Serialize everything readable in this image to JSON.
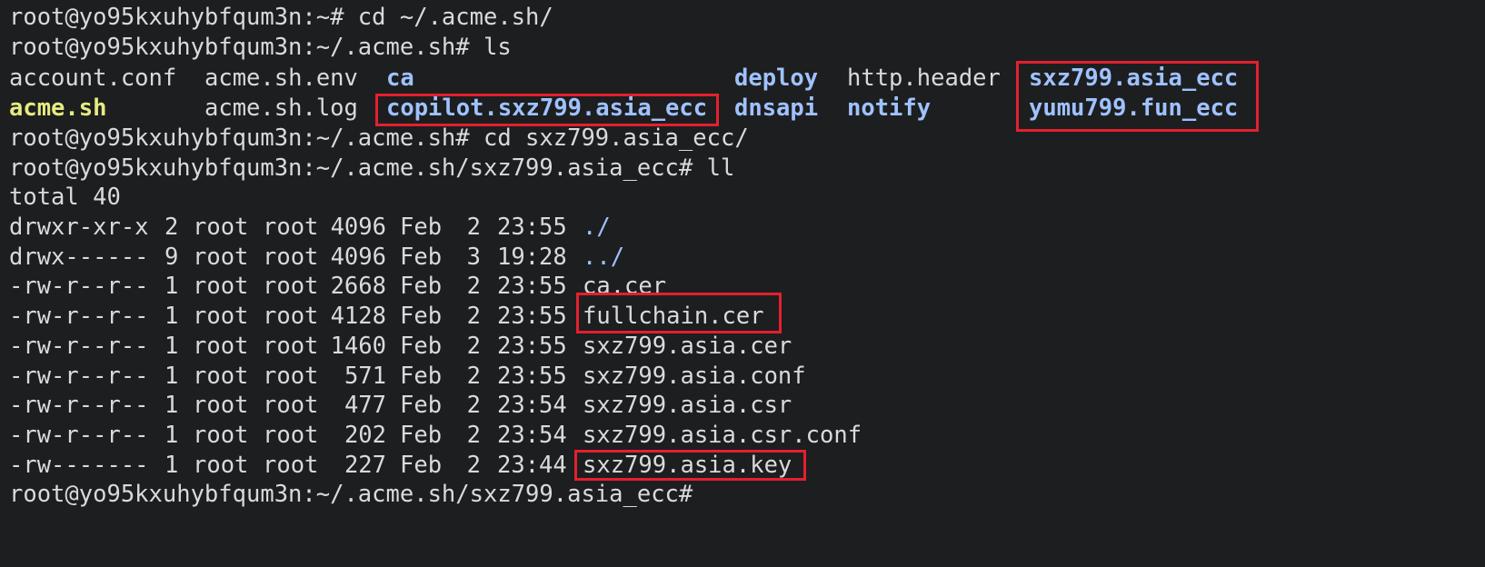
{
  "terminal": {
    "lines": [
      {
        "text": "root@yo95kxuhybfqum3n:~# cd ~/.acme.sh/"
      },
      {
        "text": "root@yo95kxuhybfqum3n:~/.acme.sh# ls"
      },
      {
        "text": "total 40"
      },
      {
        "text": "root@yo95kxuhybfqum3n:~/.acme.sh# cd sxz799.asia_ecc/"
      },
      {
        "text": "root@yo95kxuhybfqum3n:~/.acme.sh/sxz799.asia_ecc# ll"
      },
      {
        "text": "root@yo95kxuhybfqum3n:~/.acme.sh/sxz799.asia_ecc#"
      }
    ],
    "ls_output": [
      {
        "name": "account.conf",
        "kind": "file"
      },
      {
        "name": "acme.sh.env",
        "kind": "file"
      },
      {
        "name": "ca",
        "kind": "dir"
      },
      {
        "name": "deploy",
        "kind": "dir"
      },
      {
        "name": "http.header",
        "kind": "file"
      },
      {
        "name": "sxz799.asia_ecc",
        "kind": "dir"
      },
      {
        "name": "acme.sh",
        "kind": "exec"
      },
      {
        "name": "acme.sh.log",
        "kind": "file"
      },
      {
        "name": "copilot.sxz799.asia_ecc",
        "kind": "dir"
      },
      {
        "name": "dnsapi",
        "kind": "dir"
      },
      {
        "name": "notify",
        "kind": "dir"
      },
      {
        "name": "yumu799.fun_ecc",
        "kind": "dir"
      }
    ],
    "ll_output": [
      {
        "perms": "drwxr-xr-x",
        "links": "2",
        "owner": "root",
        "group": "root",
        "size": "4096",
        "month": "Feb",
        "day": "2",
        "time": "23:55",
        "name": "./",
        "is_dir": true
      },
      {
        "perms": "drwx------",
        "links": "9",
        "owner": "root",
        "group": "root",
        "size": "4096",
        "month": "Feb",
        "day": "3",
        "time": "19:28",
        "name": "../",
        "is_dir": true
      },
      {
        "perms": "-rw-r--r--",
        "links": "1",
        "owner": "root",
        "group": "root",
        "size": "2668",
        "month": "Feb",
        "day": "2",
        "time": "23:55",
        "name": "ca.cer",
        "is_dir": false
      },
      {
        "perms": "-rw-r--r--",
        "links": "1",
        "owner": "root",
        "group": "root",
        "size": "4128",
        "month": "Feb",
        "day": "2",
        "time": "23:55",
        "name": "fullchain.cer",
        "is_dir": false
      },
      {
        "perms": "-rw-r--r--",
        "links": "1",
        "owner": "root",
        "group": "root",
        "size": "1460",
        "month": "Feb",
        "day": "2",
        "time": "23:55",
        "name": "sxz799.asia.cer",
        "is_dir": false
      },
      {
        "perms": "-rw-r--r--",
        "links": "1",
        "owner": "root",
        "group": "root",
        "size": "571",
        "month": "Feb",
        "day": "2",
        "time": "23:55",
        "name": "sxz799.asia.conf",
        "is_dir": false
      },
      {
        "perms": "-rw-r--r--",
        "links": "1",
        "owner": "root",
        "group": "root",
        "size": "477",
        "month": "Feb",
        "day": "2",
        "time": "23:54",
        "name": "sxz799.asia.csr",
        "is_dir": false
      },
      {
        "perms": "-rw-r--r--",
        "links": "1",
        "owner": "root",
        "group": "root",
        "size": "202",
        "month": "Feb",
        "day": "2",
        "time": "23:54",
        "name": "sxz799.asia.csr.conf",
        "is_dir": false
      },
      {
        "perms": "-rw-------",
        "links": "1",
        "owner": "root",
        "group": "root",
        "size": "227",
        "month": "Feb",
        "day": "2",
        "time": "23:44",
        "name": "sxz799.asia.key",
        "is_dir": false
      }
    ]
  },
  "colors": {
    "background": "#1d1e20",
    "text": "#dadada",
    "directory": "#9fc2ff",
    "executable": "#e6eb7f",
    "highlight_box": "#e4202e"
  }
}
